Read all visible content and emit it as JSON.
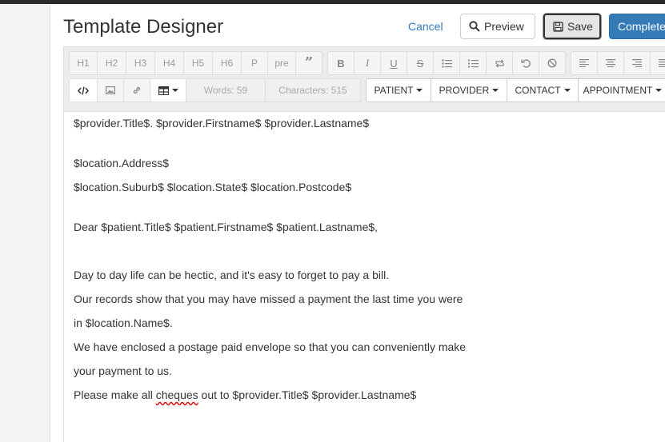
{
  "header": {
    "title": "Template Designer",
    "cancel_label": "Cancel",
    "preview_label": "Preview",
    "save_label": "Save",
    "complete_label": "Complete"
  },
  "toolbar": {
    "headings": [
      "H1",
      "H2",
      "H3",
      "H4",
      "H5",
      "H6",
      "P",
      "pre"
    ],
    "words": "Words: 59",
    "characters": "Characters: 515",
    "dropdowns": [
      "PATIENT",
      "PROVIDER",
      "CONTACT",
      "APPOINTMENT"
    ]
  },
  "editor": {
    "line1": "$provider.Title$. $provider.Firstname$ $provider.Lastname$",
    "line2": "$location.Address$",
    "line3": "$location.Suburb$ $location.State$ $location.Postcode$",
    "line4": "Dear $patient.Title$ $patient.Firstname$ $patient.Lastname$,",
    "line5": "Day to day life can be hectic, and it's easy to forget to pay a bill.",
    "line6": "Our records show that you may have missed a payment the last time you were",
    "line7": "in $location.Name$.",
    "line8": "We have enclosed a postage paid envelope so that you can conveniently make",
    "line9": "your payment to us.",
    "line10_pre": "Please make all ",
    "line10_word": "cheques",
    "line10_post": " out to $provider.Title$ $provider.Lastname$"
  }
}
